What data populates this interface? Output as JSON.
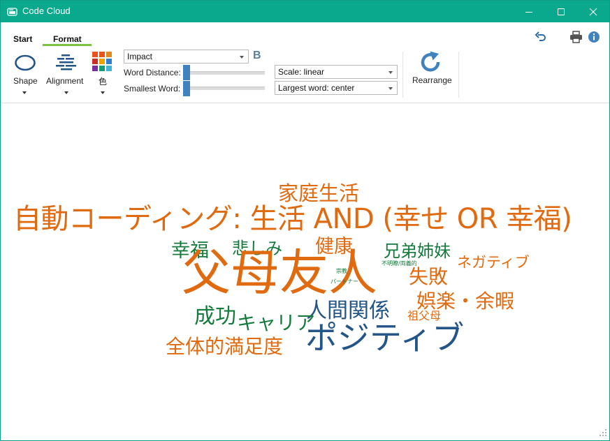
{
  "window": {
    "title": "Code Cloud"
  },
  "tabs": [
    {
      "label": "Start"
    },
    {
      "label": "Format"
    }
  ],
  "ribbon": {
    "shape": {
      "label": "Shape"
    },
    "alignment": {
      "label": "Alignment"
    },
    "color": {
      "label": "色"
    },
    "font": {
      "value": "Impact",
      "bold_label": "B"
    },
    "word_distance": {
      "label": "Word Distance:",
      "value": 0.0
    },
    "smallest_word": {
      "label": "Smallest Word:",
      "value": 0.0
    },
    "scale": {
      "value": "Scale: linear"
    },
    "largest_word": {
      "value": "Largest word: center"
    },
    "rearrange": {
      "label": "Rearrange"
    }
  },
  "colors": {
    "titlebar": "#0aa98e",
    "accent_tab": "#7cc242",
    "word_orange": "#e06a10",
    "word_green": "#147b3c",
    "word_blue": "#245589",
    "icon_blue": "#3f82bd"
  },
  "cloud": {
    "words": [
      {
        "text": "家庭生活"
      },
      {
        "text": "自動コーディング: 生活 AND (幸せ OR 幸福)"
      },
      {
        "text": "幸福"
      },
      {
        "text": "悲しみ"
      },
      {
        "text": "健康"
      },
      {
        "text": "兄弟姉妹"
      },
      {
        "text": "ネガティブ"
      },
      {
        "text": "父母友人"
      },
      {
        "text": "宗教"
      },
      {
        "text": "パートナー"
      },
      {
        "text": "不明瞭/両義的"
      },
      {
        "text": "失敗"
      },
      {
        "text": "娯楽・余暇"
      },
      {
        "text": "人間関係"
      },
      {
        "text": "祖父母"
      },
      {
        "text": "成功"
      },
      {
        "text": "キャリア"
      },
      {
        "text": "全体的満足度"
      },
      {
        "text": "ポジティブ"
      }
    ]
  }
}
